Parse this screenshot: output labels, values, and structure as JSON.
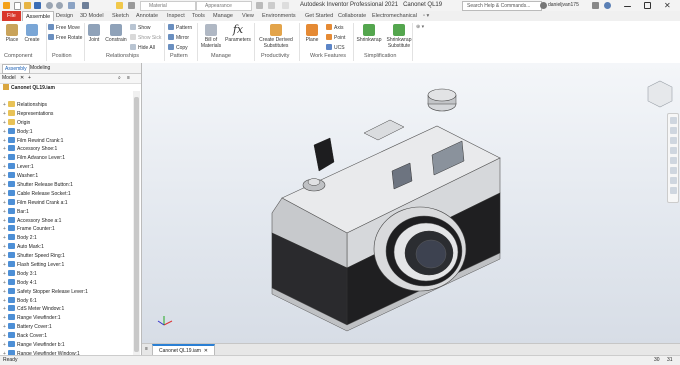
{
  "app": {
    "title": "Autodesk Inventor Professional 2021",
    "document": "Canonet QL19",
    "material_placeholder": "Material",
    "appearance_placeholder": "Appearance",
    "search_placeholder": "Search Help & Commands...",
    "user": "danieljvan175",
    "help": "?"
  },
  "ribbon_tabs": [
    "File",
    "Assemble",
    "Design",
    "3D Model",
    "Sketch",
    "Annotate",
    "Inspect",
    "Tools",
    "Manage",
    "View",
    "Environments",
    "Get Started",
    "Collaborate",
    "Electromechanical"
  ],
  "ribbon": {
    "component": {
      "label": "Component",
      "place": "Place",
      "create": "Create"
    },
    "position": {
      "label": "Position",
      "free_move": "Free Move",
      "free_rotate": "Free Rotate"
    },
    "relationships": {
      "label": "Relationships",
      "joint": "Joint",
      "constrain": "Constrain",
      "show": "Show",
      "show_sick": "Show Sick",
      "hide_all": "Hide All"
    },
    "pattern": {
      "label": "Pattern",
      "pattern": "Pattern",
      "mirror": "Mirror",
      "copy": "Copy"
    },
    "manage": {
      "label": "Manage",
      "bill_of_materials": "Bill of Materials",
      "parameters": "Parameters"
    },
    "productivity": {
      "label": "Productivity",
      "create_derived": "Create Derived Substitutes"
    },
    "work_features": {
      "label": "Work Features",
      "plane": "Plane",
      "axis": "Axis",
      "point": "Point",
      "ucs": "UCS"
    },
    "simplification": {
      "label": "Simplification",
      "shrinkwrap": "Shrinkwrap",
      "shrinkwrap_substitute": "Shrinkwrap Substitute"
    }
  },
  "browser": {
    "tabs": [
      "Assembly",
      "Modeling"
    ],
    "header": "Model",
    "root": "Canonet QL19.iam",
    "items": [
      "Relationships",
      "Representations",
      "Origin",
      "Body:1",
      "Film Rewind Crank:1",
      "Accessory Shoe:1",
      "Film Advance Lever:1",
      "Lever:1",
      "Washer:1",
      "Shutter Release Button:1",
      "Cable Release Socket:1",
      "Film Rewind Crank a:1",
      "Bar:1",
      "Accessory Shoe a:1",
      "Frame Counter:1",
      "Body 2:1",
      "Auto Mark:1",
      "Shutter Speed Ring:1",
      "Flash Setting Lever:1",
      "Body 3:1",
      "Body 4:1",
      "Safety Stopper Release Lever:1",
      "Body 6:1",
      "CdS Meter Window:1",
      "Range Viewfinder:1",
      "Battery Cover:1",
      "Back Cover:1",
      "Range Viewfinder b:1",
      "Range Viewfinder Window:1"
    ]
  },
  "doc_tab": "Canonet QL19.iam",
  "status": {
    "left": "Ready",
    "right1": "30",
    "right2": "31"
  },
  "colors": {
    "file_tab": "#d9372b",
    "accent": "#2a7fd4",
    "viewport_top": "#f4f6f9",
    "viewport_bottom": "#d7dde6"
  }
}
